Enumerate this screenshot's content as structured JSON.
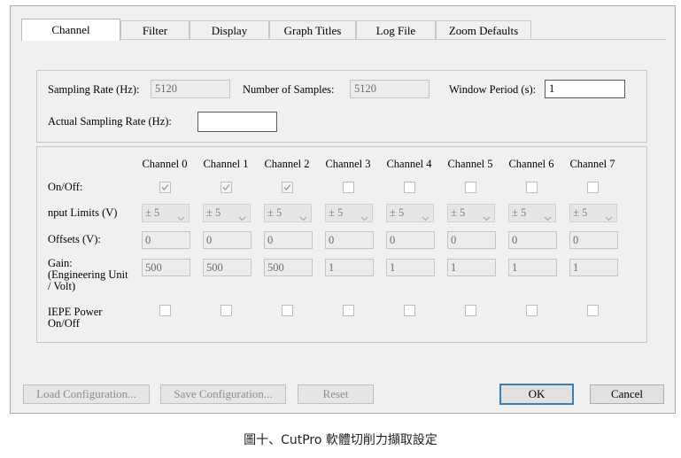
{
  "tabs": [
    {
      "label": "Channel",
      "active": true
    },
    {
      "label": "Filter",
      "active": false
    },
    {
      "label": "Display",
      "active": false
    },
    {
      "label": "Graph Titles",
      "active": false
    },
    {
      "label": "Log File",
      "active": false
    },
    {
      "label": "Zoom Defaults",
      "active": false
    }
  ],
  "sampling": {
    "sampling_rate_label": "Sampling Rate (Hz):",
    "sampling_rate_value": "5120",
    "num_samples_label": "Number of Samples:",
    "num_samples_value": "5120",
    "window_period_label": "Window Period (s):",
    "window_period_value": "1",
    "actual_rate_label": "Actual Sampling Rate (Hz):",
    "actual_rate_value": ""
  },
  "channels": {
    "headers": [
      "Channel 0",
      "Channel 1",
      "Channel 2",
      "Channel 3",
      "Channel 4",
      "Channel 5",
      "Channel 6",
      "Channel 7"
    ],
    "row_labels": {
      "onoff": "On/Off:",
      "input_limits": "nput Limits (V)",
      "offsets": "Offsets (V):",
      "gain": "Gain:\n(Engineering Unit\n/ Volt)",
      "iepe": "IEPE Power\nOn/Off"
    },
    "onoff": [
      true,
      true,
      true,
      false,
      false,
      false,
      false,
      false
    ],
    "input_limits": [
      "± 5",
      "± 5",
      "± 5",
      "± 5",
      "± 5",
      "± 5",
      "± 5",
      "± 5"
    ],
    "offsets": [
      "0",
      "0",
      "0",
      "0",
      "0",
      "0",
      "0",
      "0"
    ],
    "gain": [
      "500",
      "500",
      "500",
      "1",
      "1",
      "1",
      "1",
      "1"
    ],
    "iepe": [
      false,
      false,
      false,
      false,
      false,
      false,
      false,
      false
    ]
  },
  "buttons": {
    "load": "Load Configuration...",
    "save": "Save Configuration...",
    "reset": "Reset",
    "ok": "OK",
    "cancel": "Cancel"
  },
  "caption": "圖十、CutPro 軟體切削力擷取設定",
  "colors": {
    "dialog_bg": "#f0f0f0",
    "ok_border": "#3c7fb1",
    "disabled_text": "#8c8c8c"
  }
}
